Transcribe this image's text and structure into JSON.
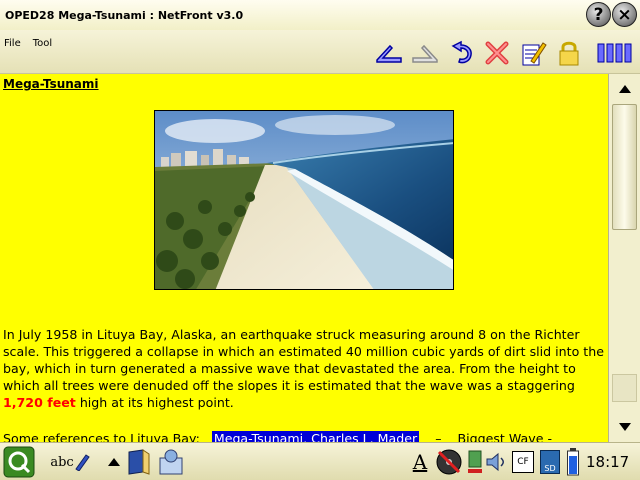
{
  "window": {
    "title": "OPED28 Mega-Tsunami : NetFront v3.0",
    "help_label": "?",
    "close_label": "×"
  },
  "menu": {
    "items": [
      "File",
      "Tool"
    ]
  },
  "toolbar": {
    "icons": [
      "back-arrow-icon",
      "forward-arrow-icon",
      "reload-icon",
      "stop-icon",
      "edit-page-icon",
      "lock-icon",
      "columns-view-icon"
    ]
  },
  "page": {
    "heading": "Mega-Tsunami",
    "image_alt_name": "beach-tsunami-photo",
    "paragraph_before": "In July 1958 in Lituya Bay, Alaska, an earthquake struck measuring around 8 on the Richter scale. This triggered a collapse in which an estimated 40 million cubic yards of dirt slid into the bay, which in turn generated a massive wave that devastated the area. From the height to which all trees were denuded off the slopes it is estimated that the wave was a staggering ",
    "highlight": "1,720 feet",
    "paragraph_after": " high at its highest point.",
    "refs_label": "Some references to Lituya Bay:",
    "ref_links": [
      "Mega-Tsunami, Charles L. Mader",
      "Biggest Wave -"
    ],
    "ref_separator": "–",
    "highlight_color": "#ff0000",
    "background_color": "#ffff00",
    "selected_link_color": "#0000d8"
  },
  "scrollbar": {
    "up_icon": "arrow-up-icon",
    "down_icon": "arrow-down-icon"
  },
  "taskbar": {
    "clock": "18:17",
    "input_method_label": "abc",
    "keyboard_label": "A",
    "cf_label": "CF",
    "sd_label": "SD"
  }
}
